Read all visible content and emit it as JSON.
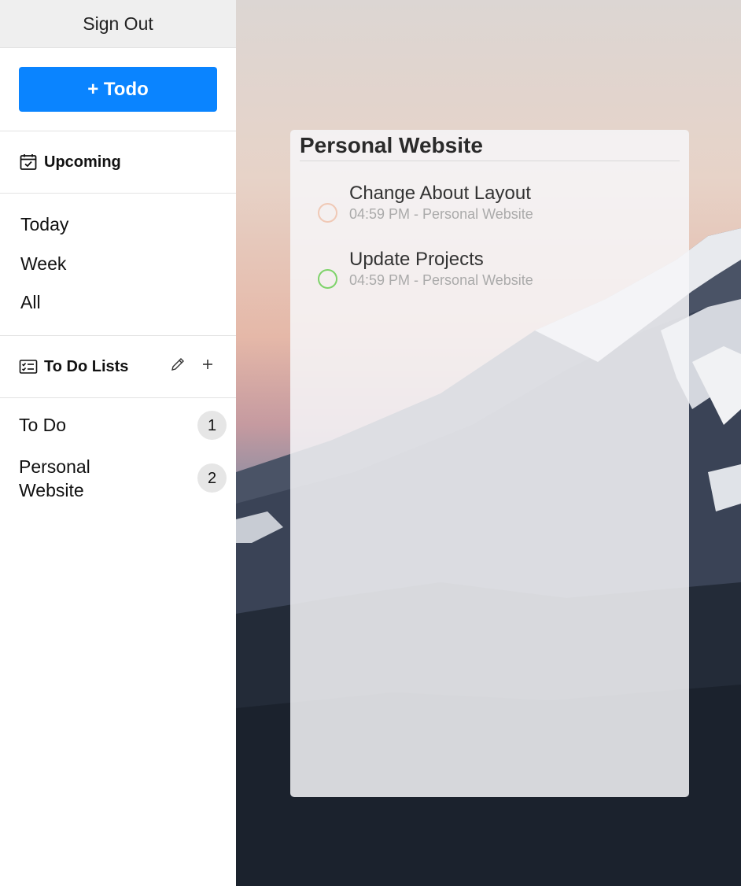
{
  "sidebar": {
    "sign_out": "Sign Out",
    "add_button": "+ Todo",
    "upcoming": {
      "icon": "calendar-check-icon",
      "label": "Upcoming"
    },
    "filters": [
      "Today",
      "Week",
      "All"
    ],
    "lists_header": {
      "icon": "checklist-icon",
      "label": "To Do Lists",
      "edit_icon": "pencil-icon",
      "add_icon": "plus-icon"
    },
    "lists": [
      {
        "label": "To Do",
        "count": "1"
      },
      {
        "label": "Personal Website",
        "count": "2"
      }
    ]
  },
  "card": {
    "title": "Personal Website",
    "tasks": [
      {
        "name": "Change About Layout",
        "meta": "04:59 PM - Personal Website",
        "ring_color": "#f0c9b6"
      },
      {
        "name": "Update Projects",
        "meta": "04:59 PM - Personal Website",
        "ring_color": "#7ed36a"
      }
    ]
  },
  "colors": {
    "accent": "#0a84ff",
    "badge_bg": "#e6e6e6"
  }
}
